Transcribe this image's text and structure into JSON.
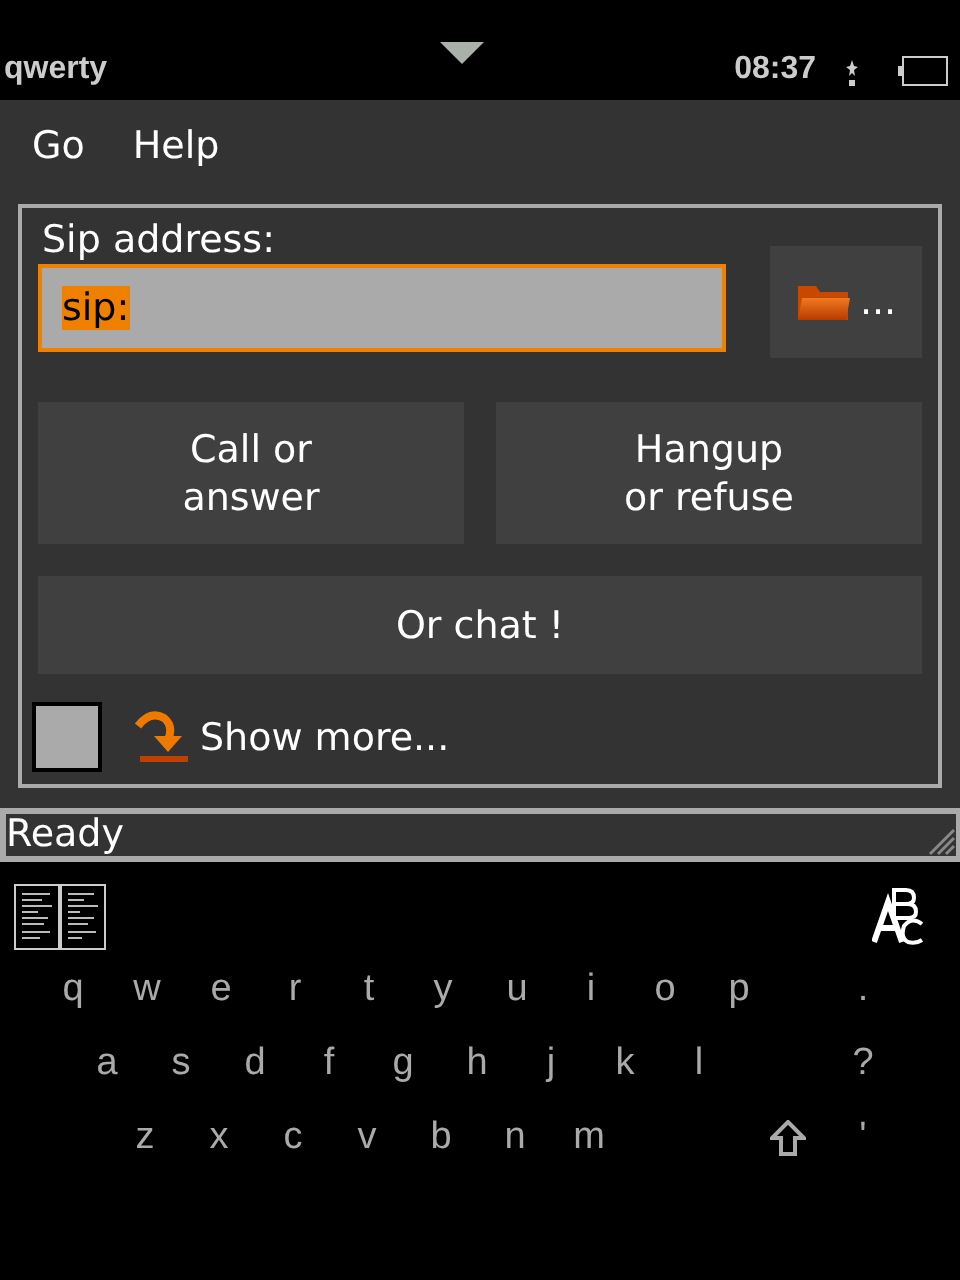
{
  "system_bar": {
    "keyboard_mode": "qwerty",
    "time": "08:37"
  },
  "menu": [
    {
      "label": "Go"
    },
    {
      "label": "Help"
    }
  ],
  "sip": {
    "label": "Sip address:",
    "value": "sip:",
    "focused": true,
    "browse_label": "..."
  },
  "buttons": [
    {
      "label": "Call or\nanswer"
    },
    {
      "label": "Hangup\nor refuse"
    }
  ],
  "chat_button": "Or chat !",
  "show_more": {
    "label": "Show more...",
    "checked": false
  },
  "status": "Ready",
  "keyboard": {
    "rows": [
      {
        "keys": [
          {
            "kind": "char",
            "label": "q"
          },
          {
            "kind": "char",
            "label": "w"
          },
          {
            "kind": "char",
            "label": "e"
          },
          {
            "kind": "char",
            "label": "r"
          },
          {
            "kind": "char",
            "label": "t"
          },
          {
            "kind": "char",
            "label": "y"
          },
          {
            "kind": "char",
            "label": "u"
          },
          {
            "kind": "char",
            "label": "i"
          },
          {
            "kind": "char",
            "label": "o"
          },
          {
            "kind": "char",
            "label": "p"
          }
        ],
        "extra": [
          {
            "kind": "char",
            "label": "."
          }
        ]
      },
      {
        "keys": [
          {
            "kind": "char",
            "label": "a"
          },
          {
            "kind": "char",
            "label": "s"
          },
          {
            "kind": "char",
            "label": "d"
          },
          {
            "kind": "char",
            "label": "f"
          },
          {
            "kind": "char",
            "label": "g"
          },
          {
            "kind": "char",
            "label": "h"
          },
          {
            "kind": "char",
            "label": "j"
          },
          {
            "kind": "char",
            "label": "k"
          },
          {
            "kind": "char",
            "label": "l"
          }
        ],
        "extra": [
          {
            "kind": "char",
            "label": "?"
          }
        ]
      },
      {
        "keys": [
          {
            "kind": "char",
            "label": "z"
          },
          {
            "kind": "char",
            "label": "x"
          },
          {
            "kind": "char",
            "label": "c"
          },
          {
            "kind": "char",
            "label": "v"
          },
          {
            "kind": "char",
            "label": "b"
          },
          {
            "kind": "char",
            "label": "n"
          },
          {
            "kind": "char",
            "label": "m"
          }
        ],
        "extra": [
          {
            "kind": "shift"
          },
          {
            "kind": "char",
            "label": "'"
          }
        ]
      }
    ]
  }
}
